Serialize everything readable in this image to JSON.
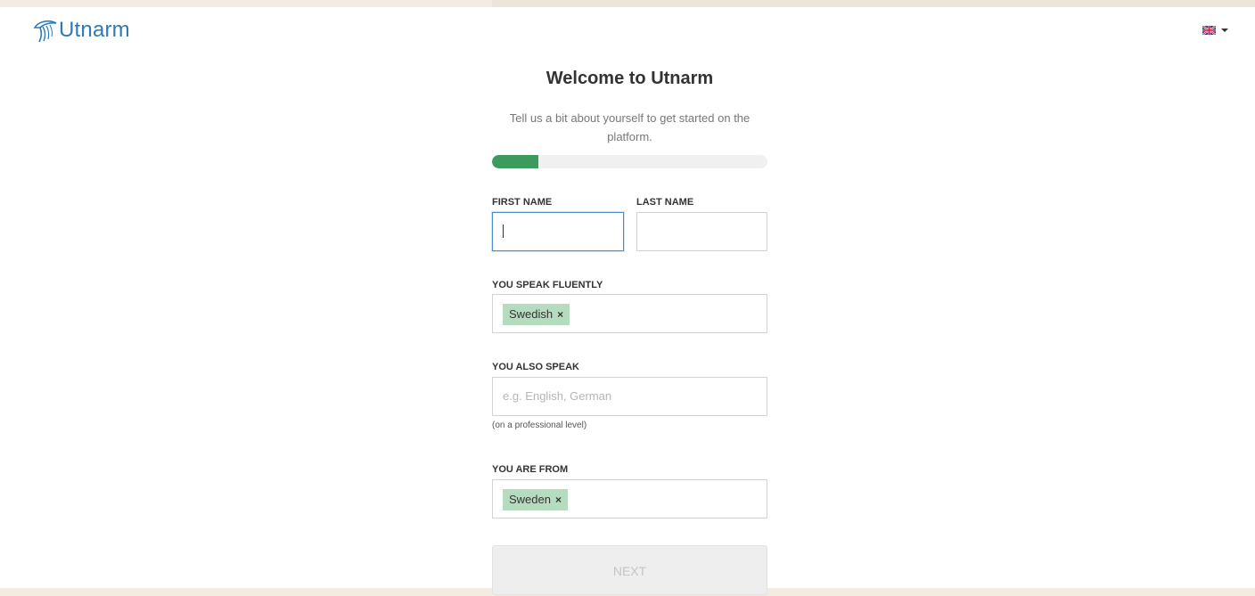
{
  "brand": {
    "name": "Utnarm",
    "color": "#2c7ab8"
  },
  "language": {
    "flag": "uk-flag-icon"
  },
  "welcome": {
    "title": "Welcome to Utnarm",
    "subtitle_line1": "Tell us a bit about yourself to get started on the",
    "subtitle_line2": "platform."
  },
  "progress": {
    "fraction": 0.167,
    "color": "#3d9a5d"
  },
  "fields": {
    "first_name": {
      "label": "FIRST NAME",
      "value": ""
    },
    "last_name": {
      "label": "LAST NAME",
      "value": ""
    },
    "speak_fluently": {
      "label": "YOU SPEAK FLUENTLY",
      "tags": [
        "Swedish"
      ]
    },
    "also_speak": {
      "label": "YOU ALSO SPEAK",
      "placeholder": "e.g. English, German",
      "hint": "(on a professional level)"
    },
    "from": {
      "label": "YOU ARE FROM",
      "tags": [
        "Sweden"
      ]
    }
  },
  "tag_remove_glyph": "×",
  "next_button": {
    "label": "NEXT"
  }
}
